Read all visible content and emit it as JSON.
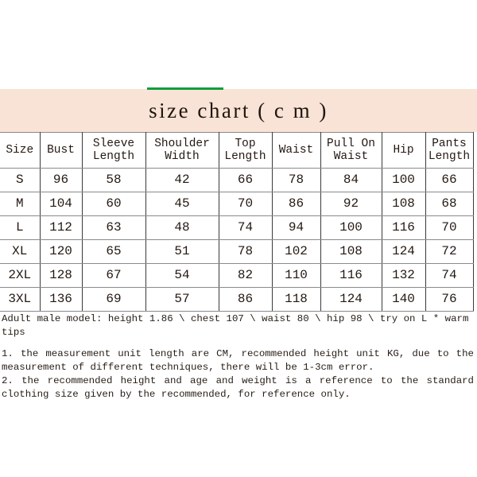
{
  "decor": {
    "green_rule": "green-rule",
    "accent_color": "#0f9d3f",
    "band_color": "#f9e3d6"
  },
  "title": {
    "text": "size chart ( c m )"
  },
  "table": {
    "headers": [
      "Size",
      "Bust",
      "Sleeve\nLength",
      "Shoulder\nWidth",
      "Top\nLength",
      "Waist",
      "Pull On\nWaist",
      "Hip",
      "Pants\nLength"
    ],
    "rows": [
      {
        "cells": [
          "S",
          "96",
          "58",
          "42",
          "66",
          "78",
          "84",
          "100",
          "66"
        ]
      },
      {
        "cells": [
          "M",
          "104",
          "60",
          "45",
          "70",
          "86",
          "92",
          "108",
          "68"
        ]
      },
      {
        "cells": [
          "L",
          "112",
          "63",
          "48",
          "74",
          "94",
          "100",
          "116",
          "70"
        ]
      },
      {
        "cells": [
          "XL",
          "120",
          "65",
          "51",
          "78",
          "102",
          "108",
          "124",
          "72"
        ]
      },
      {
        "cells": [
          "2XL",
          "128",
          "67",
          "54",
          "82",
          "110",
          "116",
          "132",
          "74"
        ]
      },
      {
        "cells": [
          "3XL",
          "136",
          "69",
          "57",
          "86",
          "118",
          "124",
          "140",
          "76"
        ]
      }
    ]
  },
  "notes": {
    "model": "Adult male model: height 1.86 \\ chest 107 \\ waist 80 \\ hip 98 \\ try on L * warm tips",
    "items": [
      "1. the measurement unit length are CM, recommended height unit KG, due to the measurement of different techniques, there will be 1-3cm error.",
      "2. the recommended height and age and weight is a reference to the standard clothing size given by the recommended, for reference only."
    ]
  }
}
